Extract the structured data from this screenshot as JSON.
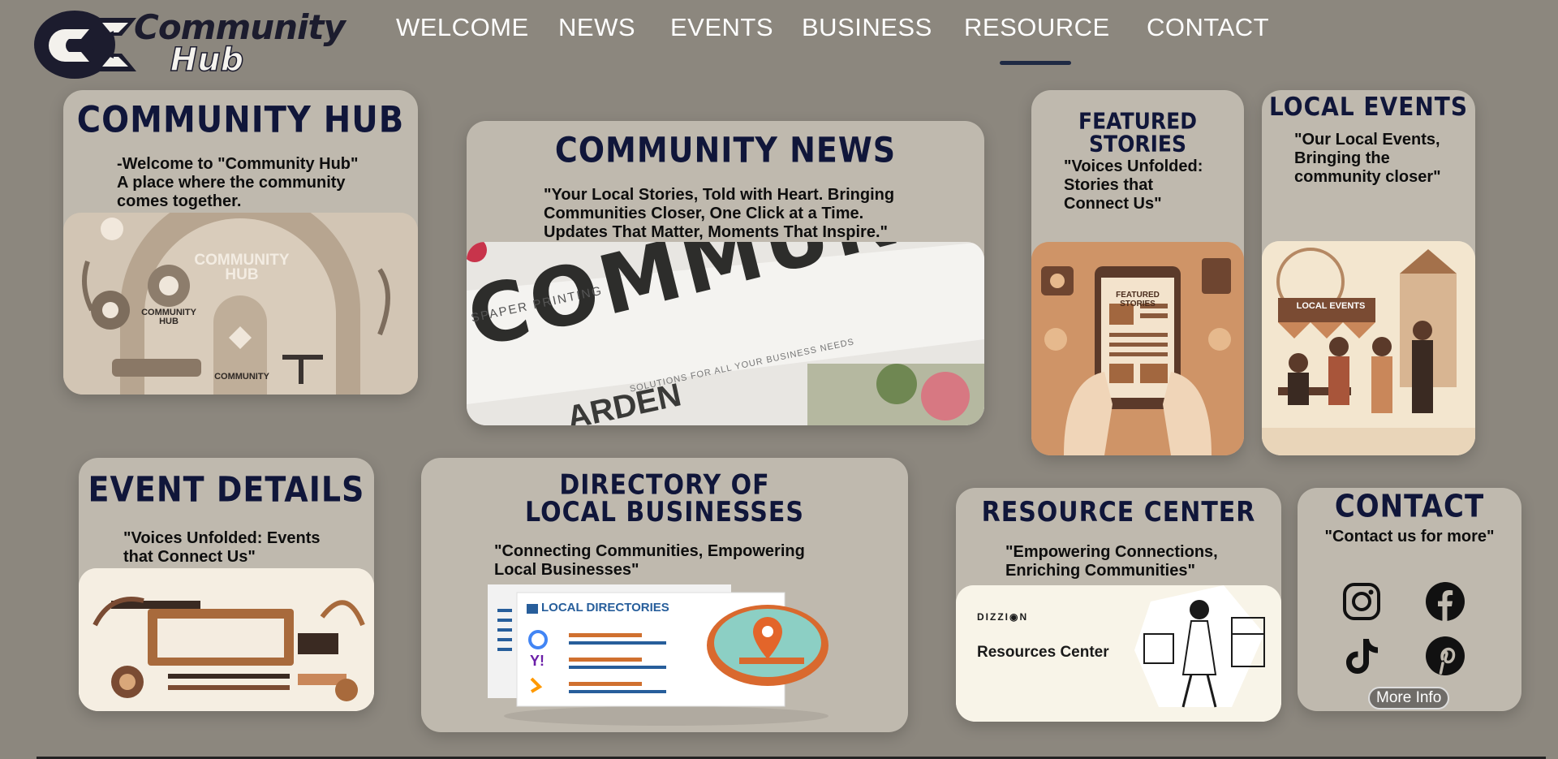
{
  "header": {
    "logo_line1": "Community",
    "logo_line2": "Hub",
    "nav": [
      "WELCOME",
      "NEWS",
      "EVENTS",
      "BUSINESS",
      "RESOURCE",
      "CONTACT"
    ],
    "active_nav": "RESOURCE"
  },
  "community_hub": {
    "title": "COMMUNITY HUB",
    "text": "-Welcome to \"Community Hub\"\nA place where the community\ncomes together.",
    "image_caption": "COMMUNITY\nHUB",
    "image_label_small": "COMMUNITY\nHUB",
    "image_label_bottom": "COMMUNITY"
  },
  "community_news": {
    "title": "COMMUNITY NEWS",
    "text": "\"Your Local Stories, Told with Heart. Bringing\nCommunities Closer, One Click at a Time.\nUpdates That Matter, Moments That Inspire.\"",
    "image_word": "COMMUNI",
    "image_line1": "SPAPER PRINTING",
    "image_line2": "SOLUTIONS FOR ALL YOUR BUSINESS NEEDS",
    "image_line3": "ARDEN"
  },
  "featured_stories": {
    "title": "FEATURED STORIES",
    "text": "\"Voices Unfolded:\nStories that\nConnect Us\"",
    "image_label": "FEATURED STORIES"
  },
  "local_events": {
    "title": "LOCAL EVENTS",
    "text": "\"Our Local Events,\nBringing the\ncommunity closer\"",
    "image_label": "LOCAL EVENTS"
  },
  "event_details": {
    "title": "EVENT DETAILS",
    "text": "\"Voices Unfolded: Events\nthat Connect Us\""
  },
  "directory": {
    "title_line1": "DIRECTORY OF",
    "title_line2": "LOCAL BUSINESSES",
    "text": "\"Connecting Communities, Empowering\nLocal Businesses\"",
    "image_label": "LOCAL DIRECTORIES"
  },
  "resource_center": {
    "title": "RESOURCE CENTER",
    "text": "\"Empowering Connections,\nEnriching Communities\"",
    "image_brand": "DIZZI◉N",
    "image_label": "Resources Center"
  },
  "contact": {
    "title": "CONTACT",
    "text": "\"Contact us for more\"",
    "button": "More Info",
    "icons": [
      "instagram-icon",
      "facebook-icon",
      "tiktok-icon",
      "pinterest-icon"
    ]
  },
  "colors": {
    "background": "#8c877e",
    "card": "#bfb9ae",
    "heading": "#10163a",
    "accent": "#1f2a44"
  }
}
